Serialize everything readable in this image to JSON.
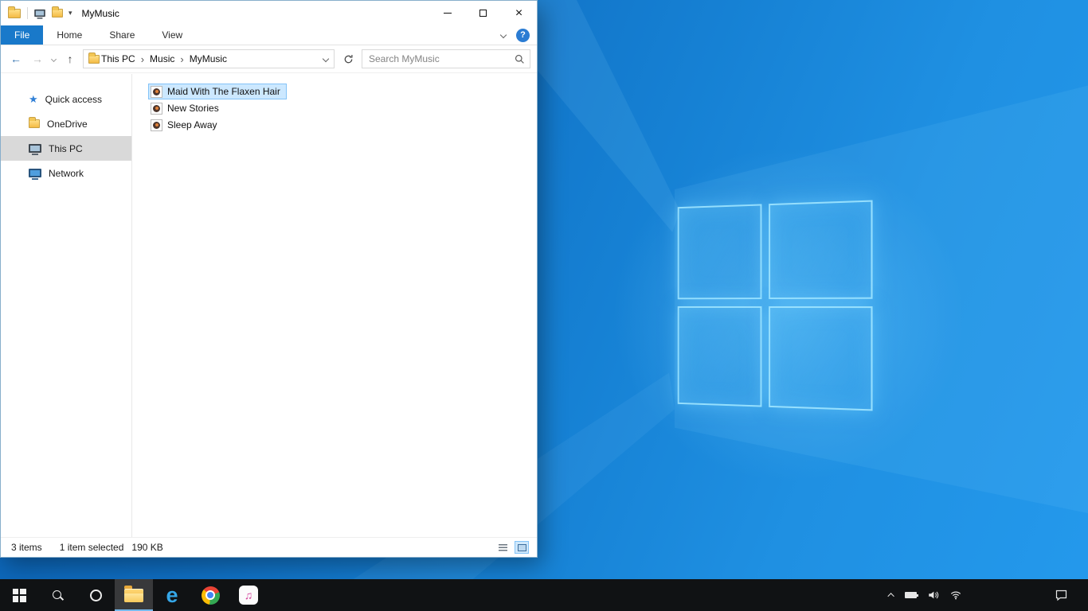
{
  "window": {
    "title": "MyMusic",
    "caption": {
      "close": "×"
    },
    "ribbon": {
      "tabs": [
        "File",
        "Home",
        "Share",
        "View"
      ],
      "help": "?"
    },
    "nav": {
      "back": "←",
      "forward": "→",
      "up": "↑"
    },
    "address": {
      "crumbs": [
        "This PC",
        "Music",
        "MyMusic"
      ],
      "separator": "›"
    },
    "search": {
      "placeholder": "Search MyMusic"
    },
    "sidebar": {
      "items": [
        {
          "label": "Quick access",
          "icon": "star-icon"
        },
        {
          "label": "OneDrive",
          "icon": "folder-icon"
        },
        {
          "label": "This PC",
          "icon": "computer-icon",
          "selected": true
        },
        {
          "label": "Network",
          "icon": "network-icon"
        }
      ]
    },
    "files": {
      "items": [
        {
          "name": "Maid With The Flaxen Hair",
          "icon": "music-file-icon",
          "selected": true
        },
        {
          "name": "New Stories",
          "icon": "music-file-icon",
          "selected": false
        },
        {
          "name": "Sleep Away",
          "icon": "music-file-icon",
          "selected": false
        }
      ]
    },
    "status": {
      "count": "3 items",
      "selected": "1 item selected",
      "size": "190 KB"
    }
  },
  "glyphs": {
    "edge": "e",
    "itunes_note": "♫",
    "quick_access_star": "★",
    "qat_chevron": "▾"
  },
  "taskbar": {
    "icons": [
      "start",
      "search",
      "cortana",
      "file-explorer",
      "edge",
      "chrome",
      "itunes"
    ],
    "active_icon": "file-explorer",
    "tray_icons": [
      "tray-expand",
      "battery",
      "volume",
      "network"
    ],
    "action_center": "action-center"
  },
  "desktop": {
    "wallpaper": "windows-10-blue-logo"
  },
  "colors": {
    "accent_tab": "#1979ca",
    "selection_bg": "#cce8ff",
    "selection_border": "#84c3f7",
    "sidebar_selected": "#d9d9d9",
    "taskbar_bg": "#101214"
  }
}
